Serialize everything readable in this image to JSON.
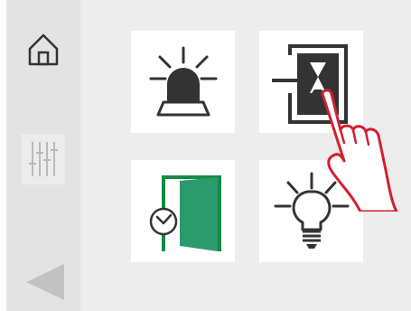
{
  "colors": {
    "sidebar_bg": "#e3e3e3",
    "panel_bg": "#ededed",
    "tile_bg": "#ffffff",
    "icon_dark": "#333333",
    "door_green": "#2b9a6d",
    "frame_green": "#138a45",
    "hand_red": "#d1202f"
  },
  "sidebar": {
    "items": [
      {
        "icon": "home-icon"
      },
      {
        "icon": "sliders-icon"
      },
      {
        "icon": "back-triangle-icon"
      }
    ]
  },
  "tiles": [
    {
      "icon": "alarm-beacon-icon"
    },
    {
      "icon": "door-timer-icon"
    },
    {
      "icon": "door-clock-icon"
    },
    {
      "icon": "light-bulb-icon"
    }
  ]
}
